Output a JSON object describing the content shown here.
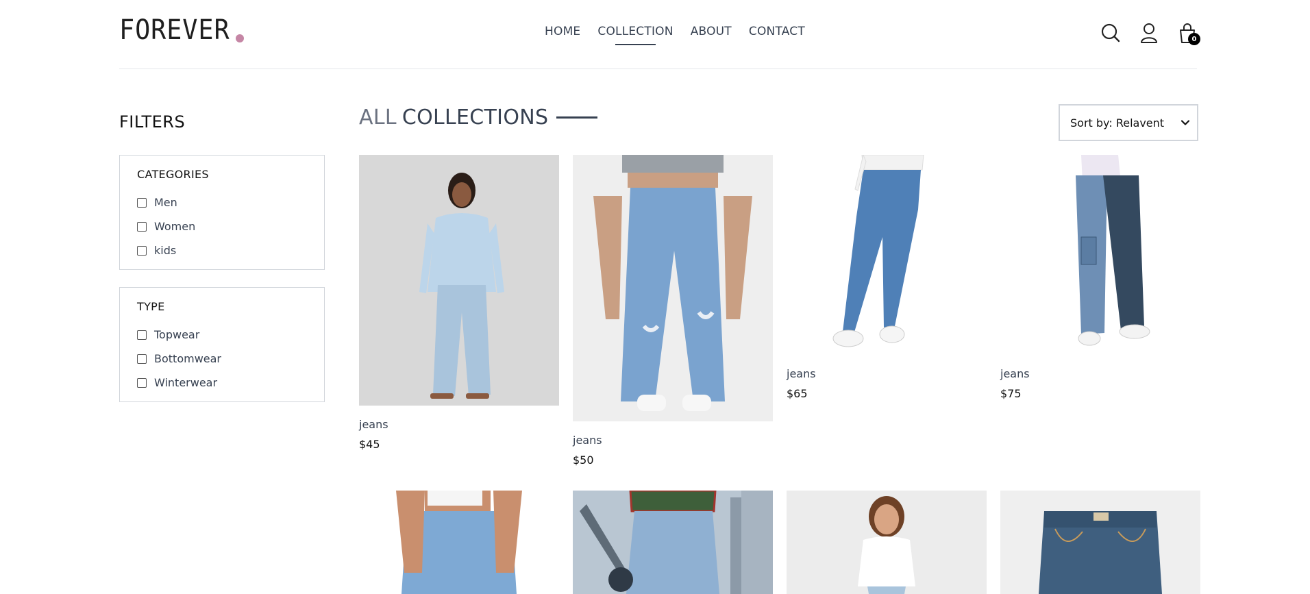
{
  "header": {
    "logo": "FOREVER",
    "nav": [
      {
        "label": "HOME"
      },
      {
        "label": "COLLECTION"
      },
      {
        "label": "ABOUT"
      },
      {
        "label": "CONTACT"
      }
    ],
    "active_nav": "COLLECTION",
    "icons": [
      "search-icon",
      "profile-icon",
      "cart-icon"
    ],
    "cart_count": "0"
  },
  "sidebar": {
    "title": "FILTERS",
    "categories": {
      "heading": "CATEGORIES",
      "options": [
        {
          "label": "Men",
          "checked": false
        },
        {
          "label": "Women",
          "checked": false
        },
        {
          "label": "kids",
          "checked": false
        }
      ]
    },
    "type": {
      "heading": "TYPE",
      "options": [
        {
          "label": "Topwear",
          "checked": false
        },
        {
          "label": "Bottomwear",
          "checked": false
        },
        {
          "label": "Winterwear",
          "checked": false
        }
      ]
    }
  },
  "main": {
    "title_part1": "ALL",
    "title_part2": "COLLECTIONS",
    "sort": {
      "selected": "Sort by: Relavent"
    },
    "products": [
      {
        "name": "jeans",
        "price": "$45"
      },
      {
        "name": "jeans",
        "price": "$50"
      },
      {
        "name": "jeans",
        "price": "$65"
      },
      {
        "name": "jeans",
        "price": "$75"
      },
      {
        "name": "",
        "price": ""
      },
      {
        "name": "",
        "price": ""
      },
      {
        "name": "",
        "price": ""
      },
      {
        "name": "",
        "price": ""
      }
    ]
  },
  "colors": {
    "accent_dot": "#c586a5",
    "text_dark": "#374151",
    "denim_light": "#a9c4dc",
    "denim_mid": "#6e95bf",
    "denim_dark": "#3b5777"
  }
}
